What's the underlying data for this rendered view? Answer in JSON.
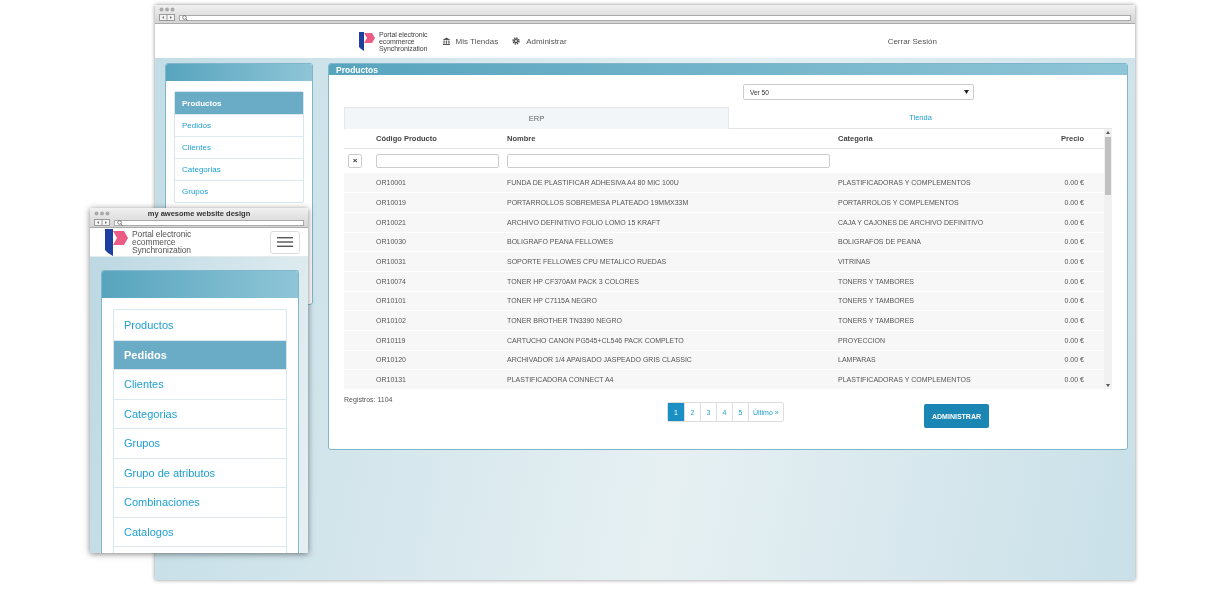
{
  "desktop_window": {
    "header": {
      "logo_text": [
        "Portal electronic",
        "ecommerce",
        "Synchronization"
      ],
      "nav": [
        {
          "label": "Mis Tiendas"
        },
        {
          "label": "Administrar"
        }
      ],
      "logout": "Cerrar Sesión"
    },
    "sidebar": {
      "items": [
        {
          "label": "Productos",
          "selected": true
        },
        {
          "label": "Pedidos",
          "selected": false
        },
        {
          "label": "Clientes",
          "selected": false
        },
        {
          "label": "Categorias",
          "selected": false
        },
        {
          "label": "Grupos",
          "selected": false
        }
      ]
    },
    "products_panel": {
      "title": "Productos",
      "page_size": "Ver 50",
      "tabs": [
        {
          "label": "ERP",
          "selected": true
        },
        {
          "label": "Tienda",
          "selected": false
        }
      ],
      "table": {
        "columns": [
          "Código Producto",
          "Nombre",
          "Categoria",
          "Precio"
        ],
        "clear_filter": "×",
        "rows": [
          [
            "OR10001",
            "FUNDA DE PLASTIFICAR ADHESIVA A4 80 MIC 100U",
            "PLASTIFICADORAS Y COMPLEMENTOS",
            "0.00 €"
          ],
          [
            "OR10019",
            "PORTARROLLOS SOBREMESA PLATEADO 19MMX33M",
            "PORTARROLOS Y COMPLEMENTOS",
            "0.00 €"
          ],
          [
            "OR10021",
            "ARCHIVO DEFINITIVO FOLIO LOMO 15 KRAFT",
            "CAJA Y CAJONES DE ARCHIVO DEFINITIVO",
            "0.00 €"
          ],
          [
            "OR10030",
            "BOLIGRAFO PEANA FELLOWES",
            "BOLIGRAFOS DE PEANA",
            "0.00 €"
          ],
          [
            "OR10031",
            "SOPORTE FELLOWES CPU METALICO RUEDAS",
            "VITRINAS",
            "0.00 €"
          ],
          [
            "OR10074",
            "TONER HP CF370AM PACK 3 COLORES",
            "TONERS Y TAMBORES",
            "0.00 €"
          ],
          [
            "OR10101",
            "TONER HP C7115A NEGRO",
            "TONERS Y TAMBORES",
            "0.00 €"
          ],
          [
            "OR10102",
            "TONER BROTHER TN3390 NEGRO",
            "TONERS Y TAMBORES",
            "0.00 €"
          ],
          [
            "OR10119",
            "CARTUCHO CANON PG545+CL546 PACK COMPLETO",
            "PROYECCION",
            "0.00 €"
          ],
          [
            "OR10120",
            "ARCHIVADOR 1/4 APAISADO JASPEADO GRIS CLASSIC",
            "LAMPARAS",
            "0.00 €"
          ],
          [
            "OR10131",
            "PLASTIFICADORA CONNECT A4",
            "PLASTIFICADORAS Y COMPLEMENTOS",
            "0.00 €"
          ]
        ]
      },
      "record_count": "Registros: 1104",
      "pagination": [
        {
          "label": "1",
          "selected": true
        },
        {
          "label": "2",
          "selected": false
        },
        {
          "label": "3",
          "selected": false
        },
        {
          "label": "4",
          "selected": false
        },
        {
          "label": "5",
          "selected": false
        },
        {
          "label": "Último »",
          "selected": false
        }
      ],
      "button": "ADMINISTRAR"
    }
  },
  "mobile_window": {
    "title": "my awesome website design",
    "header": {
      "logo_text": [
        "Portal electronic",
        "ecommerce",
        "Synchronization"
      ]
    },
    "sidebar": {
      "items": [
        {
          "label": "Productos",
          "selected": false
        },
        {
          "label": "Pedidos",
          "selected": true
        },
        {
          "label": "Clientes",
          "selected": false
        },
        {
          "label": "Categorias",
          "selected": false
        },
        {
          "label": "Grupos",
          "selected": false
        },
        {
          "label": "Grupo de atributos",
          "selected": false
        },
        {
          "label": "Combinaciones",
          "selected": false
        },
        {
          "label": "Catalogos",
          "selected": false
        }
      ]
    }
  }
}
